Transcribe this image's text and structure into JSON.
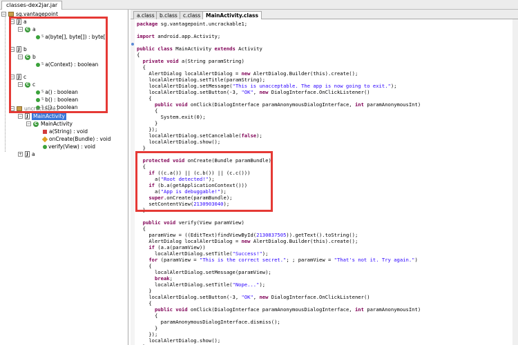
{
  "file_tab": {
    "label": "classes-dex2jar.jar"
  },
  "tree": {
    "root": "sg.vantagepoint",
    "pkg_a": "a",
    "class_a": "a",
    "method_a": "a(byte[], byte[]) : byte[]",
    "pkg_b": "b",
    "class_b": "b",
    "method_b": "a(Context) : boolean",
    "pkg_c": "c",
    "class_c": "c",
    "method_c1": "a() : boolean",
    "method_c2": "b() : boolean",
    "method_c3": "c() : boolean",
    "pkg_uncrackable": "uncrackable1",
    "file_main": "MainActivity",
    "class_main": "MainActivity",
    "method_m1": "a(String) : void",
    "method_m2": "onCreate(Bundle) : void",
    "method_m3": "verify(View) : void",
    "file_a2": "a"
  },
  "code_tabs": [
    "a.class",
    "b.class",
    "c.class",
    "MainActivity.class"
  ],
  "code_lines": [
    "package sg.vantagepoint.uncrackable1;",
    "",
    "import android.app.Activity;",
    "",
    "public class MainActivity extends Activity",
    "{",
    "  private void a(String paramString)",
    "  {",
    "    AlertDialog localAlertDialog = new AlertDialog.Builder(this).create();",
    "    localAlertDialog.setTitle(paramString);",
    "    localAlertDialog.setMessage(\"This is unacceptable. The app is now going to exit.\");",
    "    localAlertDialog.setButton(-3, \"OK\", new DialogInterface.OnClickListener()",
    "    {",
    "      public void onClick(DialogInterface paramAnonymousDialogInterface, int paramAnonymousInt)",
    "      {",
    "        System.exit(0);",
    "      }",
    "    });",
    "    localAlertDialog.setCancelable(false);",
    "    localAlertDialog.show();",
    "  }",
    "",
    "  protected void onCreate(Bundle paramBundle)",
    "  {",
    "    if ((c.a()) || (c.b()) || (c.c()))",
    "      a(\"Root detected!\");",
    "    if (b.a(getApplicationContext()))",
    "      a(\"App is debuggable!\");",
    "    super.onCreate(paramBundle);",
    "    setContentView(2130903040);",
    "  }",
    "",
    "  public void verify(View paramView)",
    "  {",
    "    paramView = ((EditText)findViewById(2130837505)).getText().toString();",
    "    AlertDialog localAlertDialog = new AlertDialog.Builder(this).create();",
    "    if (a.a(paramView))",
    "      localAlertDialog.setTitle(\"Success!\");",
    "    for (paramView = \"This is the correct secret.\"; ; paramView = \"That's not it. Try again.\")",
    "    {",
    "      localAlertDialog.setMessage(paramView);",
    "      break;",
    "      localAlertDialog.setTitle(\"Nope...\");",
    "    }",
    "    localAlertDialog.setButton(-3, \"OK\", new DialogInterface.OnClickListener()",
    "    {",
    "      public void onClick(DialogInterface paramAnonymousDialogInterface, int paramAnonymousInt)",
    "      {",
    "        paramAnonymousDialogInterface.dismiss();",
    "      }",
    "    });",
    "    localAlertDialog.show();",
    "  }",
    "}"
  ],
  "colors": {
    "highlight_box": "#e53935",
    "selection": "#3875d7",
    "keyword": "#7f0055",
    "string": "#2a00ff"
  }
}
